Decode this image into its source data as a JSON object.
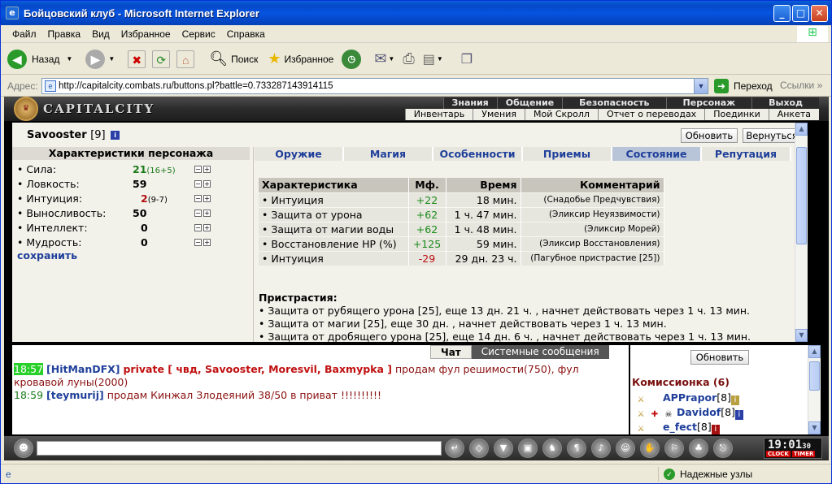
{
  "window": {
    "title": "Бойцовский клуб - Microsoft Internet Explorer"
  },
  "menu": [
    "Файл",
    "Правка",
    "Вид",
    "Избранное",
    "Сервис",
    "Справка"
  ],
  "toolbar": {
    "back": "Назад",
    "search": "Поиск",
    "favorites": "Избранное"
  },
  "address": {
    "label": "Адрес:",
    "url": "http://capitalcity.combats.ru/buttons.pl?battle=0.733287143914115",
    "go": "Переход",
    "links": "Ссылки"
  },
  "game": {
    "logo": "CAPITALCITY",
    "nav_top": [
      "Знания",
      "Общение",
      "Безопасность",
      "Персонаж",
      "Выход"
    ],
    "nav_bottom": [
      "Инвентарь",
      "Умения",
      "Мой Скролл",
      "Отчет о переводах",
      "Поединки",
      "Анкета"
    ]
  },
  "player": {
    "name": "Savooster",
    "level": "[9]"
  },
  "buttons": {
    "refresh": "Обновить",
    "back": "Вернуться"
  },
  "char": {
    "title": "Характеристики персонажа",
    "stats": [
      {
        "name": "• Сила:",
        "value": "21",
        "extra": "(16+5)",
        "color": "#1a7a1a"
      },
      {
        "name": "• Ловкость:",
        "value": "59",
        "extra": "",
        "color": "#000000"
      },
      {
        "name": "• Интуиция:",
        "value": "2",
        "extra": "(9-7)",
        "color": "#b01010"
      },
      {
        "name": "• Выносливость:",
        "value": "50",
        "extra": "",
        "color": "#000000"
      },
      {
        "name": "• Интеллект:",
        "value": "0",
        "extra": "",
        "color": "#000000"
      },
      {
        "name": "• Мудрость:",
        "value": "0",
        "extra": "",
        "color": "#000000"
      }
    ],
    "save": "сохранить"
  },
  "tabs": [
    "Оружие",
    "Магия",
    "Особенности",
    "Приемы",
    "Состояние",
    "Репутация"
  ],
  "effects": {
    "headers": [
      "Характеристика",
      "Мф.",
      "Время",
      "Комментарий"
    ],
    "rows": [
      {
        "name": "• Интуиция",
        "mf": "+22",
        "time": "18 мин.",
        "comment": "(Снадобье Предчувствия)",
        "mfcolor": "#1a8a1a"
      },
      {
        "name": "• Защита от урона",
        "mf": "+62",
        "time": "1 ч. 47 мин.",
        "comment": "(Эликсир Неуязвимости)",
        "mfcolor": "#1a8a1a"
      },
      {
        "name": "• Защита от магии воды",
        "mf": "+62",
        "time": "1 ч. 48 мин.",
        "comment": "(Эликсир Морей)",
        "mfcolor": "#1a8a1a"
      },
      {
        "name": "• Восстановление HP (%)",
        "mf": "+125",
        "time": "59 мин.",
        "comment": "(Эликсир Восстановления)",
        "mfcolor": "#1a8a1a"
      },
      {
        "name": "• Интуиция",
        "mf": "-29",
        "time": "29 дн. 23 ч.",
        "comment": "(Пагубное пристрастие [25])",
        "mfcolor": "#c01010"
      }
    ]
  },
  "addictions": {
    "title": "Пристрастия:",
    "items": [
      "• Защита от рубящего урона [25], еще 13 дн. 21 ч. , начнет действовать через 1 ч. 13 мин.",
      "• Защита от магии [25], еще 30 дн. , начнет действовать через 1 ч. 13 мин.",
      "• Защита от дробящего урона [25], еще 14 дн. 6 ч. , начнет действовать через 1 ч. 13 мин."
    ]
  },
  "chat": {
    "tabs": [
      "Чат",
      "Системные сообщения"
    ],
    "msg1": {
      "time": "18:57",
      "user": "[HitManDFX]",
      "private": "private [ чвд, Savooster, Moresvil, Baxmypka ]",
      "text": "продам фул решимости(750), фул кровавой луны(2000)"
    },
    "msg2": {
      "time": "18:59",
      "user": "[teymurij]",
      "text": "продам Кинжал Злодеяний 38/50 в приват !!!!!!!!!!"
    }
  },
  "commission": {
    "refresh": "Обновить",
    "title": "Комиссионка (6)",
    "players": [
      {
        "name": "APPrapor",
        "level": "[8]"
      },
      {
        "name": "Davidof",
        "level": "[8]"
      },
      {
        "name": "e_fect",
        "level": "[8]"
      }
    ]
  },
  "clock": {
    "time": "19:01",
    "sec": "30",
    "l1": "CLOCK",
    "l2": "TIMER"
  },
  "status": {
    "zone": "Надежные узлы"
  }
}
